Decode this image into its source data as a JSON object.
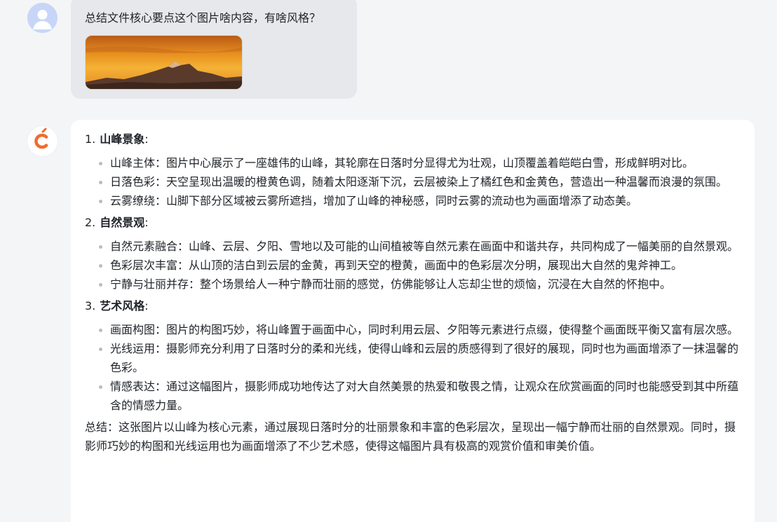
{
  "user": {
    "message": "总结文件核心要点这个图片啥内容，有啥风格？",
    "image_alt": "sunset-mountain-photo"
  },
  "assistant": {
    "sections": [
      {
        "number": "1.",
        "heading": "山峰景象",
        "colon": ":",
        "items": [
          "山峰主体：图片中心展示了一座雄伟的山峰，其轮廓在日落时分显得尤为壮观，山顶覆盖着皑皑白雪，形成鲜明对比。",
          "日落色彩：天空呈现出温暖的橙黄色调，随着太阳逐渐下沉，云层被染上了橘红色和金黄色，营造出一种温馨而浪漫的氛围。",
          "云雾缭绕：山脚下部分区域被云雾所遮挡，增加了山峰的神秘感，同时云雾的流动也为画面增添了动态美。"
        ]
      },
      {
        "number": "2.",
        "heading": "自然景观",
        "colon": ":",
        "items": [
          "自然元素融合：山峰、云层、夕阳、雪地以及可能的山间植被等自然元素在画面中和谐共存，共同构成了一幅美丽的自然景观。",
          "色彩层次丰富：从山顶的洁白到云层的金黄，再到天空的橙黄，画面中的色彩层次分明，展现出大自然的鬼斧神工。",
          "宁静与壮丽并存：整个场景给人一种宁静而壮丽的感觉，仿佛能够让人忘却尘世的烦恼，沉浸在大自然的怀抱中。"
        ]
      },
      {
        "number": "3.",
        "heading": "艺术风格",
        "colon": ":",
        "items": [
          "画面构图：图片的构图巧妙，将山峰置于画面中心，同时利用云层、夕阳等元素进行点缀，使得整个画面既平衡又富有层次感。",
          "光线运用：摄影师充分利用了日落时分的柔和光线，使得山峰和云层的质感得到了很好的展现，同时也为画面增添了一抹温馨的色彩。",
          "情感表达：通过这幅图片，摄影师成功地传达了对大自然美景的热爱和敬畏之情，让观众在欣赏画面的同时也能感受到其中所蕴含的情感力量。"
        ]
      }
    ],
    "summary": "总结：这张图片以山峰为核心元素，通过展现日落时分的壮丽景象和丰富的色彩层次，呈现出一幅宁静而壮丽的自然景观。同时，摄影师巧妙的构图和光线运用也为画面增添了不少艺术感，使得这幅图片具有极高的观赏价值和审美价值。"
  },
  "colors": {
    "page_bg": "#f4f5f7",
    "user_bubble": "#e6e8eb",
    "assistant_card": "#ffffff",
    "brand_orange": "#f26b2a"
  }
}
